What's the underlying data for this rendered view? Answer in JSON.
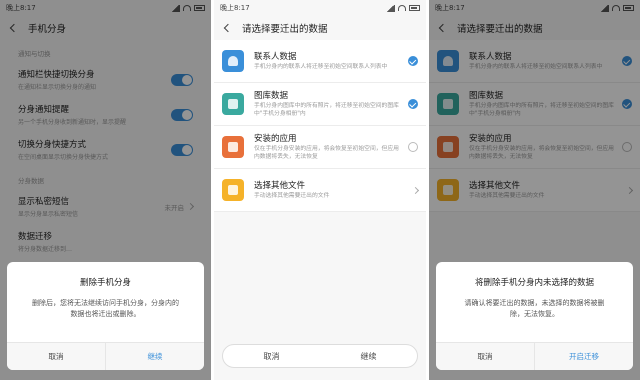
{
  "screen1": {
    "status_time": "晚上8:17",
    "title": "手机分身",
    "section_notify": "通知与切换",
    "items": [
      {
        "title": "通知栏快捷切换分身",
        "sub": "在通知栏显示切换分身的通知"
      },
      {
        "title": "分身通知提醒",
        "sub": "另一个手机分身收到新通知时，显示提醒"
      },
      {
        "title": "切换分身快捷方式",
        "sub": "在空间桌面显示切换分身快捷方式"
      }
    ],
    "section_data": "分身数据",
    "sms": {
      "title": "显示私密短信",
      "sub": "显示分身显示私密短信",
      "value": "未开启"
    },
    "migrate": {
      "title": "数据迁移",
      "sub": "将分身数据迁移到…"
    },
    "dialog": {
      "title": "删除手机分身",
      "body": "删除后，您将无法继续访问手机分身，分身内的数据也将迁出或删除。",
      "cancel": "取消",
      "confirm": "继续"
    }
  },
  "screen2": {
    "status_time": "晚上8:17",
    "title": "请选择要迁出的数据",
    "items": [
      {
        "title": "联系人数据",
        "sub": "手机分身内的联系人将迁移至初始空间联系人列表中",
        "icon": "contacts-icon",
        "checked": true
      },
      {
        "title": "图库数据",
        "sub": "手机分身内图库中的所有照片，将迁移至初始空间的图库中\"手机分身相册\"内",
        "icon": "gallery-icon",
        "checked": true
      },
      {
        "title": "安装的应用",
        "sub": "仅在手机分身安装的应用，将会恢复至初始空间，但应用内数据将丢失，无法恢复",
        "icon": "apps-icon",
        "checked": false
      },
      {
        "title": "选择其他文件",
        "sub": "手动选择其他需要迁出的文件",
        "icon": "folder-icon"
      }
    ],
    "cancel": "取消",
    "confirm": "继续"
  },
  "screen3": {
    "status_time": "晚上8:17",
    "title": "请选择要迁出的数据",
    "items": [
      {
        "title": "联系人数据",
        "sub": "手机分身内的联系人将迁移至初始空间联系人列表中"
      },
      {
        "title": "图库数据",
        "sub": "手机分身内图库中的所有照片，将迁移至初始空间的图库中\"手机分身相册\"内"
      },
      {
        "title": "安装的应用",
        "sub": "仅在手机分身安装的应用，将会恢复至初始空间，但应用内数据将丢失，无法恢复"
      },
      {
        "title": "选择其他文件",
        "sub": "手动选择其他需要迁出的文件"
      }
    ],
    "dialog": {
      "title": "将删除手机分身内未选择的数据",
      "body": "请确认将要迁出的数据，未选择的数据将被删除，无法恢复。",
      "cancel": "取消",
      "confirm": "开启迁移"
    }
  },
  "colors": {
    "accent": "#3a8fd9",
    "contacts": "#3a8fd9",
    "gallery": "#3aa99f",
    "apps": "#e8703a",
    "files": "#f5b229"
  }
}
